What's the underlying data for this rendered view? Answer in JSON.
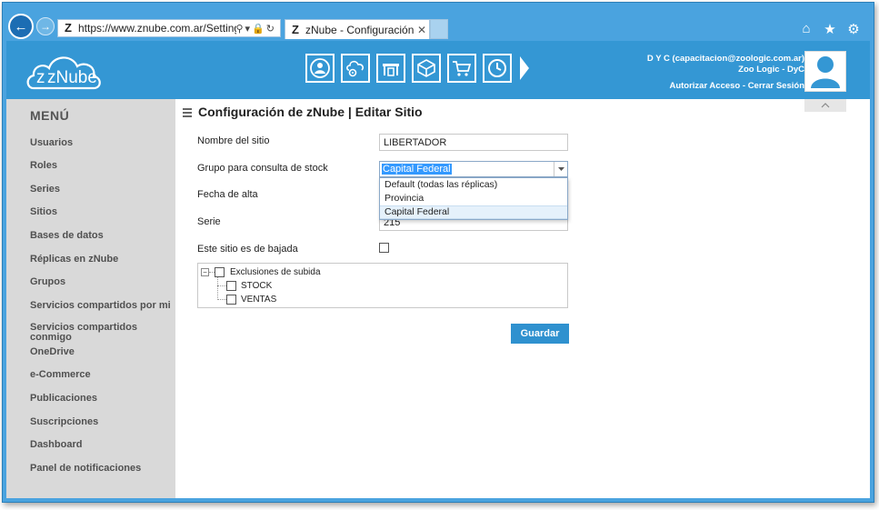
{
  "browser": {
    "address": "https://www.znube.com.ar/Settings/Edi",
    "tab_title": "zNube - Configuración de z...",
    "favicon_letter": "Z"
  },
  "header": {
    "logo_text": "zNube",
    "user_line": "D Y C (capacitacion@zoologic.com.ar)",
    "company_line": "Zoo Logic - DyC",
    "authorize": "Autorizar Acceso",
    "logout": "Cerrar Sesión",
    "icons": [
      "users-icon",
      "cloud-settings-icon",
      "warehouse-icon",
      "box-icon",
      "cart-icon",
      "clock-icon",
      "next-arrow-icon"
    ]
  },
  "sidebar": {
    "title": "MENÚ",
    "items": [
      "Usuarios",
      "Roles",
      "Series",
      "Sitios",
      "Bases de datos",
      "Réplicas en zNube",
      "Grupos",
      "Servicios compartidos por mi",
      "Servicios compartidos conmigo",
      "OneDrive",
      "e-Commerce",
      "Publicaciones",
      "Suscripciones",
      "Dashboard",
      "Panel de notificaciones"
    ]
  },
  "main": {
    "title": "Configuración de zNube | Editar Sitio",
    "fields": {
      "name_label": "Nombre del sitio",
      "name_value": "LIBERTADOR",
      "group_label": "Grupo para consulta de stock",
      "group_value": "Capital Federal",
      "date_label": "Fecha de alta",
      "serie_label": "Serie",
      "serie_value": "215",
      "bajada_label": "Este sitio es de bajada"
    },
    "dropdown_options": [
      "Default (todas las réplicas)",
      "Provincia",
      "Capital Federal"
    ],
    "tree": {
      "root": "Exclusiones de subida",
      "children": [
        "STOCK",
        "VENTAS"
      ]
    },
    "save_label": "Guardar"
  },
  "colors": {
    "brand_blue": "#3497d4",
    "button_blue": "#2f91cf",
    "sidebar_bg": "#d9d9d9"
  }
}
